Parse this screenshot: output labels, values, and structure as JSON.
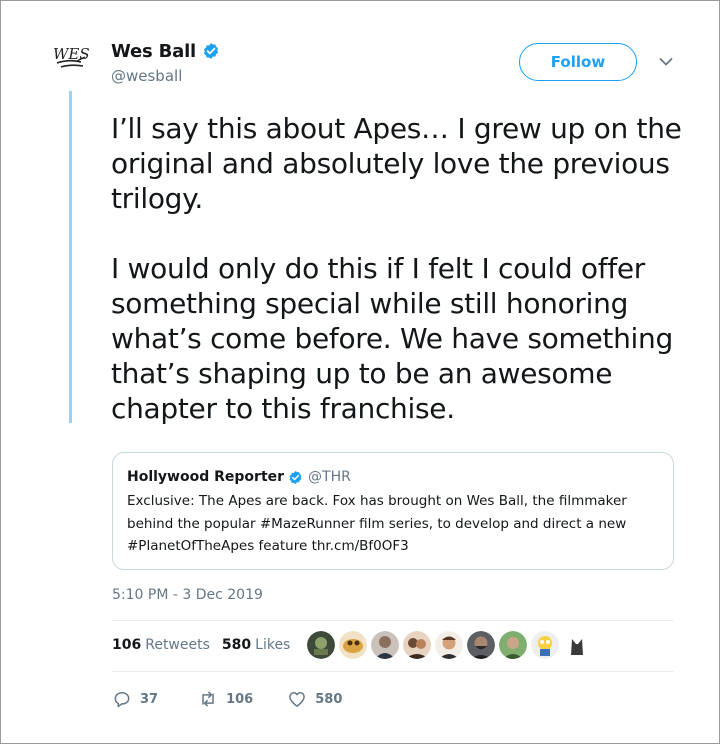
{
  "author": {
    "display_name": "Wes Ball",
    "handle": "@wesball",
    "logo_text": "WES",
    "verified_icon": "verified-badge-icon"
  },
  "follow_button": {
    "label": "Follow"
  },
  "tweet": {
    "paragraphs": [
      "I’ll say this about Apes… I grew up on the original and absolutely love the previous trilogy.",
      "I would only do this if I felt I could offer something special while still honoring what’s come before. We have something that’s shaping up to be an awesome chapter to this franchise."
    ]
  },
  "quoted_tweet": {
    "author": "Hollywood Reporter",
    "handle": "@THR",
    "text": "Exclusive: The Apes are back. Fox has brought on Wes Ball, the filmmaker behind the popular #MazeRunner film series, to develop and direct a new #PlanetOfTheApes feature thr.cm/Bf0OF3"
  },
  "timestamp": "5:10 PM - 3 Dec 2019",
  "stats": {
    "retweets_count": "106",
    "retweets_label": "Retweets",
    "likes_count": "580",
    "likes_label": "Likes"
  },
  "liker_avatars": [
    "avatar-1",
    "avatar-2",
    "avatar-3",
    "avatar-4",
    "avatar-5",
    "avatar-6",
    "avatar-7",
    "avatar-8",
    "avatar-9"
  ],
  "actions": {
    "reply_count": "37",
    "retweet_count": "106",
    "like_count": "580"
  },
  "colors": {
    "accent": "#1da1f2",
    "thread_line": "#9ad1f4",
    "muted_text": "#657786",
    "border": "#ccd6dd"
  }
}
